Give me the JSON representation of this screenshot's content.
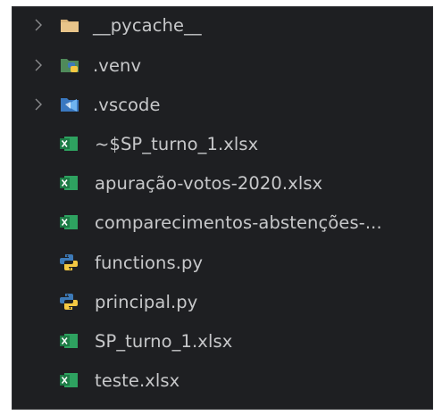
{
  "explorer": {
    "items": [
      {
        "label": "__pycache__",
        "type": "folder",
        "icon": "folder-icon",
        "expandable": true
      },
      {
        "label": ".venv",
        "type": "folder",
        "icon": "python-folder-icon",
        "expandable": true
      },
      {
        "label": ".vscode",
        "type": "folder",
        "icon": "vscode-folder-icon",
        "expandable": true
      },
      {
        "label": "~$SP_turno_1.xlsx",
        "type": "file",
        "icon": "excel-file-icon",
        "expandable": false
      },
      {
        "label": "apuração-votos-2020.xlsx",
        "type": "file",
        "icon": "excel-file-icon",
        "expandable": false
      },
      {
        "label": "comparecimentos-abstenções-...",
        "type": "file",
        "icon": "excel-file-icon",
        "expandable": false
      },
      {
        "label": "functions.py",
        "type": "file",
        "icon": "python-file-icon",
        "expandable": false
      },
      {
        "label": "principal.py",
        "type": "file",
        "icon": "python-file-icon",
        "expandable": false
      },
      {
        "label": "SP_turno_1.xlsx",
        "type": "file",
        "icon": "excel-file-icon",
        "expandable": false
      },
      {
        "label": "teste.xlsx",
        "type": "file",
        "icon": "excel-file-icon",
        "expandable": false
      }
    ]
  },
  "colors": {
    "background": "#1e1f22",
    "text": "#c7c8ca",
    "chevron": "#8a8b8d",
    "folder": "#d9b37a",
    "excel": "#1f8a4a",
    "python_blue": "#3d7ab8",
    "python_yellow": "#f4c842",
    "vscode_blue": "#3a8ee0"
  }
}
